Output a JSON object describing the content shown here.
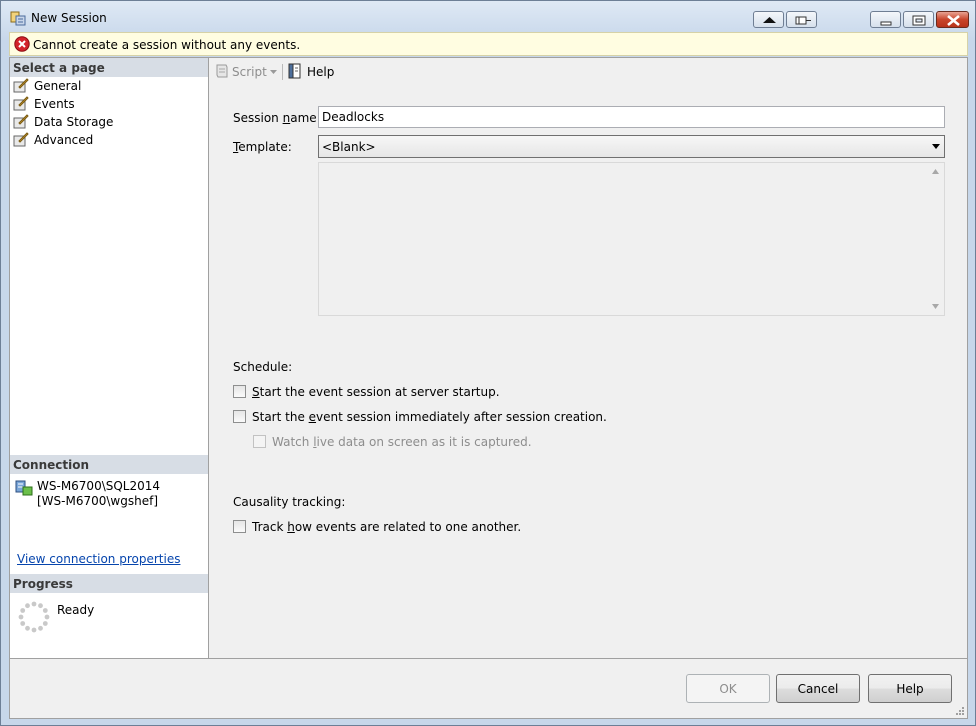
{
  "window": {
    "title": "New Session"
  },
  "infobar": {
    "message": "Cannot create a session without any events."
  },
  "sidebar": {
    "header": "Select a page",
    "pages": [
      {
        "label": "General"
      },
      {
        "label": "Events"
      },
      {
        "label": "Data Storage"
      },
      {
        "label": "Advanced"
      }
    ],
    "connection_header": "Connection",
    "server": "WS-M6700\\SQL2014",
    "user": "[WS-M6700\\wgshef]",
    "connection_link": "View connection properties",
    "progress_header": "Progress",
    "progress_status": "Ready"
  },
  "toolbar": {
    "script_label": "Script",
    "help_label": "Help"
  },
  "form": {
    "session_name_label_pre": "Session ",
    "session_name_label_u": "n",
    "session_name_label_post": "ame:",
    "session_name_value": "Deadlocks",
    "template_label_u": "T",
    "template_label_post": "emplate:",
    "template_value": "<Blank>",
    "schedule_title": "Schedule:",
    "opt_startup_u": "S",
    "opt_startup_post": "tart the event session at server startup.",
    "opt_startup_checked": false,
    "opt_immediate_pre": "Start the ",
    "opt_immediate_u": "e",
    "opt_immediate_post": "vent session immediately after session creation.",
    "opt_immediate_checked": false,
    "opt_watch_pre": "Watch ",
    "opt_watch_u": "l",
    "opt_watch_post": "ive data on screen as it is captured.",
    "opt_watch_checked": false,
    "causality_title": "Causality tracking:",
    "opt_track_pre": "Track ",
    "opt_track_u": "h",
    "opt_track_post": "ow events are related to one another.",
    "opt_track_checked": false
  },
  "buttons": {
    "ok": "OK",
    "cancel": "Cancel",
    "help": "Help"
  },
  "colors": {
    "infobar_bg": "#fffde1",
    "section_header_bg": "#d7dde5",
    "link": "#0645ad",
    "error_red": "#d3222a"
  }
}
